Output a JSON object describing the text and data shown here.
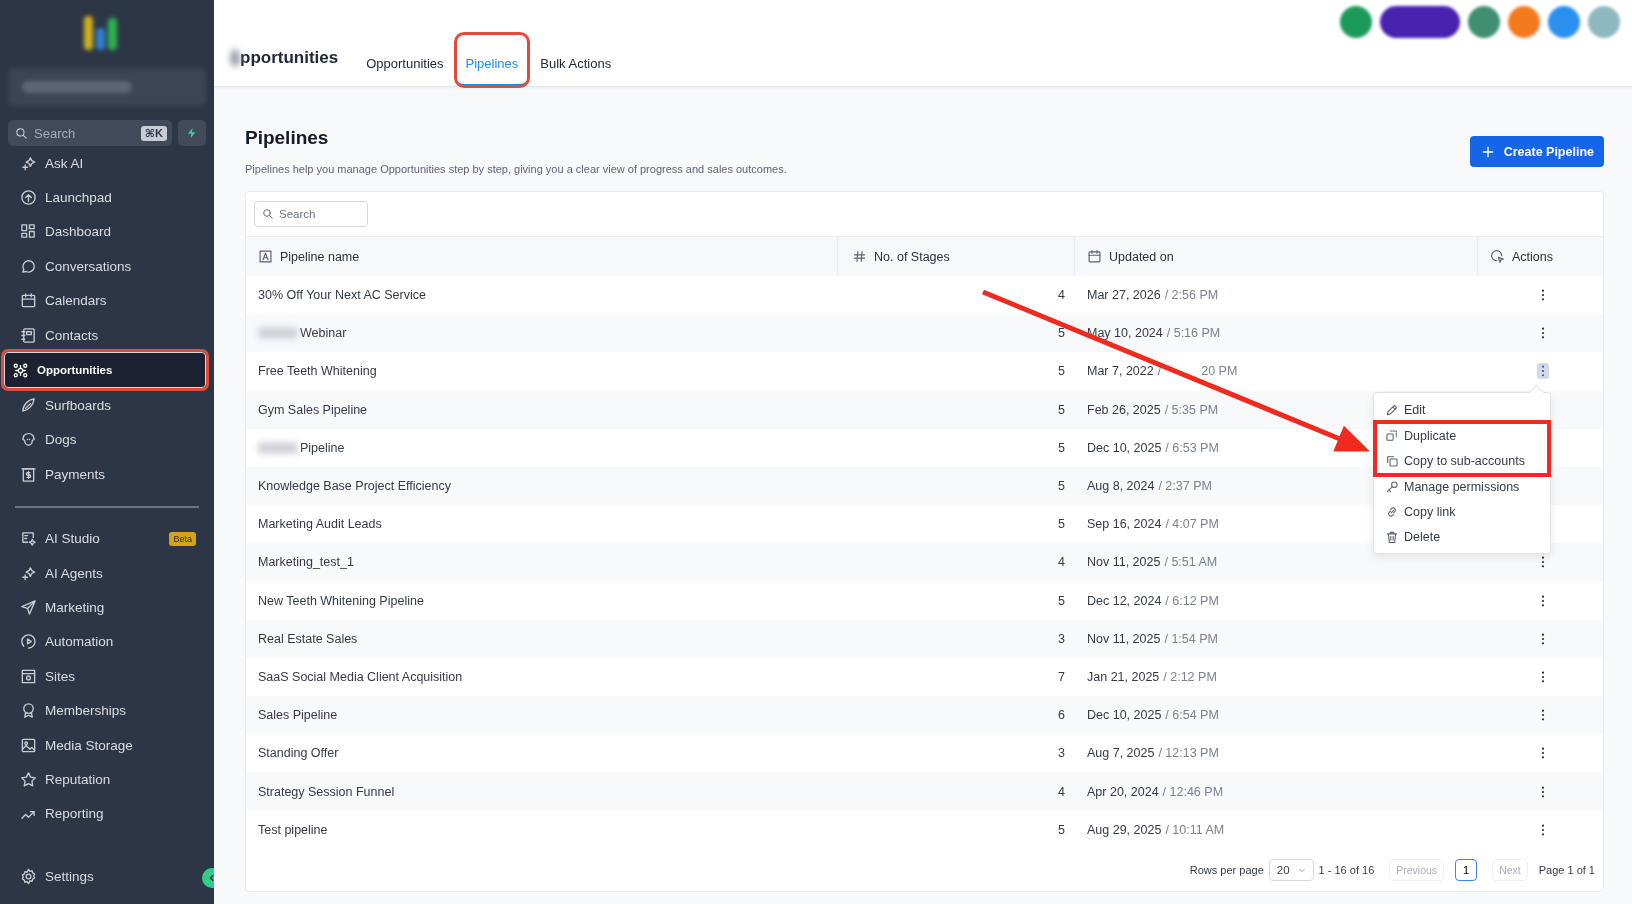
{
  "sidebar": {
    "search": {
      "placeholder": "Search",
      "shortcut": "⌘K"
    },
    "sections": [
      [
        {
          "label": "Ask AI",
          "selected": false,
          "highlighted": false
        },
        {
          "label": "Launchpad",
          "selected": false,
          "highlighted": false
        },
        {
          "label": "Dashboard",
          "selected": false,
          "highlighted": false
        },
        {
          "label": "Conversations",
          "selected": false,
          "highlighted": false
        },
        {
          "label": "Calendars",
          "selected": false,
          "highlighted": false
        },
        {
          "label": "Contacts",
          "selected": false,
          "highlighted": false
        },
        {
          "label": "Opportunities",
          "selected": true,
          "highlighted": true
        },
        {
          "label": "Surfboards",
          "selected": false,
          "highlighted": false
        },
        {
          "label": "Dogs",
          "selected": false,
          "highlighted": false
        },
        {
          "label": "Payments",
          "selected": false,
          "highlighted": false
        }
      ],
      [
        {
          "label": "AI Studio",
          "badge": "Beta",
          "selected": false,
          "highlighted": false
        },
        {
          "label": "AI Agents",
          "selected": false,
          "highlighted": false
        },
        {
          "label": "Marketing",
          "selected": false,
          "highlighted": false
        },
        {
          "label": "Automation",
          "selected": false,
          "highlighted": false
        },
        {
          "label": "Sites",
          "selected": false,
          "highlighted": false
        },
        {
          "label": "Memberships",
          "selected": false,
          "highlighted": false
        },
        {
          "label": "Media Storage",
          "selected": false,
          "highlighted": false
        },
        {
          "label": "Reputation",
          "selected": false,
          "highlighted": false
        },
        {
          "label": "Reporting",
          "selected": false,
          "highlighted": false
        }
      ]
    ],
    "settings": {
      "label": "Settings"
    }
  },
  "header": {
    "title": "pportunities",
    "tabs": [
      {
        "label": "Opportunities",
        "selected": false,
        "highlighted": false
      },
      {
        "label": "Pipelines",
        "selected": true,
        "highlighted": true
      },
      {
        "label": "Bulk Actions",
        "selected": false,
        "highlighted": false
      }
    ]
  },
  "page": {
    "title": "Pipelines",
    "description": "Pipelines help you manage Opportunities step by step, giving you a clear view of progress and sales outcomes.",
    "create_button": "Create Pipeline"
  },
  "table": {
    "search": {
      "placeholder": "Search"
    },
    "columns": [
      {
        "label": "Pipeline name"
      },
      {
        "label": "No. of Stages"
      },
      {
        "label": "Updated on"
      },
      {
        "label": "Actions"
      }
    ],
    "rows": [
      {
        "name": "30% Off Your Next AC Service",
        "redacted_prefix": false,
        "stages": "4",
        "date": "Mar 27, 2026",
        "time": [
          "/ 2:56 PM"
        ],
        "menu_open": false
      },
      {
        "name": "Webinar",
        "redacted_prefix": true,
        "stages": "5",
        "date": "May 10, 2024",
        "time": [
          "/ 5:16 PM"
        ],
        "menu_open": false
      },
      {
        "name": "Free Teeth Whitening",
        "redacted_prefix": false,
        "stages": "5",
        "date": "Mar 7, 2022",
        "time": [
          "/",
          "20 PM"
        ],
        "menu_open": true
      },
      {
        "name": "Gym Sales Pipeline",
        "redacted_prefix": false,
        "stages": "5",
        "date": "Feb 26, 2025",
        "time": [
          "/ 5:35 PM"
        ],
        "menu_open": false
      },
      {
        "name": "Pipeline",
        "redacted_prefix": true,
        "stages": "5",
        "date": "Dec 10, 2025",
        "time": [
          "/ 6:53 PM"
        ],
        "menu_open": false
      },
      {
        "name": "Knowledge Base Project Efficiency",
        "redacted_prefix": false,
        "stages": "5",
        "date": "Aug 8, 2024",
        "time": [
          "/ 2:37 PM"
        ],
        "menu_open": false
      },
      {
        "name": "Marketing Audit Leads",
        "redacted_prefix": false,
        "stages": "5",
        "date": "Sep 16, 2024",
        "time": [
          "/ 4:07 PM"
        ],
        "menu_open": false
      },
      {
        "name": "Marketing_test_1",
        "redacted_prefix": false,
        "stages": "4",
        "date": "Nov 11, 2025",
        "time": [
          "/ 5:51 AM"
        ],
        "menu_open": false
      },
      {
        "name": "New Teeth Whitening Pipeline",
        "redacted_prefix": false,
        "stages": "5",
        "date": "Dec 12, 2024",
        "time": [
          "/ 6:12 PM"
        ],
        "menu_open": false
      },
      {
        "name": "Real Estate Sales",
        "redacted_prefix": false,
        "stages": "3",
        "date": "Nov 11, 2025",
        "time": [
          "/ 1:54 PM"
        ],
        "menu_open": false
      },
      {
        "name": "SaaS Social Media Client Acquisition",
        "redacted_prefix": false,
        "stages": "7",
        "date": "Jan 21, 2025",
        "time": [
          "/ 2:12 PM"
        ],
        "menu_open": false
      },
      {
        "name": "Sales Pipeline",
        "redacted_prefix": false,
        "stages": "6",
        "date": "Dec 10, 2025",
        "time": [
          "/ 6:54 PM"
        ],
        "menu_open": false
      },
      {
        "name": "Standing Offer",
        "redacted_prefix": false,
        "stages": "3",
        "date": "Aug 7, 2025",
        "time": [
          "/ 12:13 PM"
        ],
        "menu_open": false
      },
      {
        "name": "Strategy Session Funnel",
        "redacted_prefix": false,
        "stages": "4",
        "date": "Apr 20, 2024",
        "time": [
          "/ 12:46 PM"
        ],
        "menu_open": false
      },
      {
        "name": "Test pipeline",
        "redacted_prefix": false,
        "stages": "5",
        "date": "Aug 29, 2025",
        "time": [
          "/ 10:11 AM"
        ],
        "menu_open": false
      }
    ],
    "row_menu": [
      {
        "label": "Edit",
        "highlighted": false
      },
      {
        "label": "Duplicate",
        "highlighted": true
      },
      {
        "label": "Copy to sub-accounts",
        "highlighted": true
      },
      {
        "label": "Manage permissions",
        "highlighted": false
      },
      {
        "label": "Copy link",
        "highlighted": false
      },
      {
        "label": "Delete",
        "highlighted": false
      }
    ],
    "footer": {
      "rows_label": "Rows per page",
      "rows_value": "20",
      "range": "1 - 16 of 16",
      "previous": {
        "label": "Previous",
        "disabled": true
      },
      "pages": [
        {
          "label": "1",
          "selected": true
        }
      ],
      "next": {
        "label": "Next",
        "disabled": true
      },
      "page_info": "Page 1 of 1"
    }
  }
}
